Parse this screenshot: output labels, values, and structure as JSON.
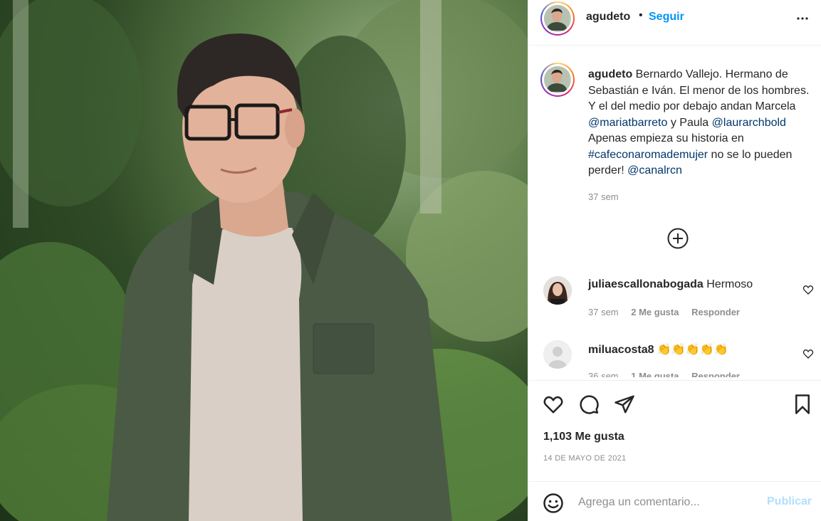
{
  "post": {
    "username": "agudeto",
    "separator": "•",
    "follow_label": "Seguir",
    "more_icon": "more-horizontal-icon"
  },
  "caption": {
    "username": "agudeto",
    "text_1": " Bernardo Vallejo. Hermano de Sebastián e Iván. El menor de los hombres. Y el del medio por debajo andan Marcela ",
    "mention_1": "@mariatbarreto",
    "text_2": " y Paula ",
    "mention_2": "@laurarchbold",
    "text_3": " Apenas empieza su historia en ",
    "hashtag": "#cafeconaromademujer",
    "text_4": " no se lo pueden perder! ",
    "mention_3": "@canalrcn",
    "time": "37 sem"
  },
  "comments": [
    {
      "username": "juliaescallonabogada",
      "text": " Hermoso",
      "time": "37 sem",
      "likes": "2 Me gusta",
      "reply": "Responder"
    },
    {
      "username": "miluacosta8",
      "text": " 👏👏👏👏👏",
      "time": "36 sem",
      "likes": "1 Me gusta",
      "reply": "Responder"
    }
  ],
  "actions": {
    "likes": "1,103 Me gusta",
    "date": "14 DE MAYO DE 2021"
  },
  "add_comment": {
    "placeholder": "Agrega un comentario...",
    "publish_label": "Publicar"
  },
  "colors": {
    "accent": "#0095f6",
    "link": "#00376b",
    "muted": "#8e8e8e",
    "publish_disabled": "#b2dffc"
  }
}
